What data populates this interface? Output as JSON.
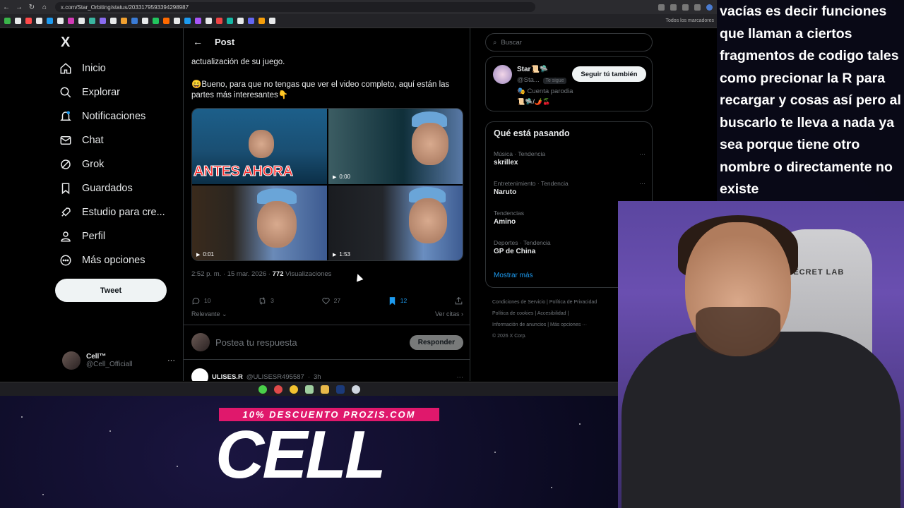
{
  "browser": {
    "url": "x.com/Star_Orbiting/status/2033179593394298987",
    "bookmarks_label": "Todos los marcadores"
  },
  "left_nav": {
    "logo": "X",
    "items": [
      {
        "label": "Inicio",
        "icon": "home-icon"
      },
      {
        "label": "Explorar",
        "icon": "search-icon"
      },
      {
        "label": "Notificaciones",
        "icon": "bell-icon"
      },
      {
        "label": "Chat",
        "icon": "mail-icon"
      },
      {
        "label": "Grok",
        "icon": "grok-icon"
      },
      {
        "label": "Guardados",
        "icon": "bookmark-icon"
      },
      {
        "label": "Estudio para cre...",
        "icon": "rocket-icon"
      },
      {
        "label": "Perfil",
        "icon": "person-icon"
      },
      {
        "label": "Más opciones",
        "icon": "more-circle-icon"
      }
    ],
    "tweet_button": "Tweet",
    "account": {
      "name": "Cell™",
      "handle": "@Cell_Officiall"
    }
  },
  "post": {
    "header_title": "Post",
    "text_top": "actualización de su juego.",
    "text_main": "😄Bueno, para que no tengas que ver el video completo, aquí están las partes más interesantes👇",
    "media": {
      "thumb1_overlay": "ANTES AHORA",
      "thumb2_duration": "0:00",
      "thumb3_duration": "0:01",
      "thumb4_duration": "1:53"
    },
    "time": "2:52 p. m.",
    "date": "15 mar. 2026",
    "views_count": "772",
    "views_label": "Visualizaciones",
    "actions": {
      "replies": "10",
      "reposts": "3",
      "likes": "27",
      "bookmarks": "12"
    },
    "sort_label": "Relevante",
    "quotes_label": "Ver citas",
    "reply_placeholder": "Postea tu respuesta",
    "reply_button": "Responder",
    "next_reply": {
      "name": "ULISES.R",
      "handle": "@ULISESR495587",
      "time": "3h"
    }
  },
  "right": {
    "search_placeholder": "Buscar",
    "profile": {
      "name": "Star📜🛸",
      "handle": "@Sta...",
      "follows_you": "Te sigue",
      "parody": "Cuenta parodia",
      "emojis": "📜🛸/🌶️🍒",
      "follow_button": "Seguir tú también"
    },
    "trends_title": "Qué está pasando",
    "trends": [
      {
        "category": "Música · Tendencia",
        "title": "skrillex"
      },
      {
        "category": "Entretenimiento · Tendencia",
        "title": "Naruto"
      },
      {
        "category": "Tendencias",
        "title": "Amino"
      },
      {
        "category": "Deportes · Tendencia",
        "title": "GP de China"
      }
    ],
    "show_more": "Mostrar más",
    "footer": {
      "terms": "Condiciones de Servicio",
      "privacy": "Política de Privacidad",
      "cookies": "Política de cookies",
      "accessibility": "Accesibilidad",
      "ads": "Información de anuncios",
      "more": "Más opciones ···",
      "copyright": "© 2026 X Corp."
    }
  },
  "overlay_caption": "vacías es decir funciones que llaman a ciertos fragmentos de codigo tales como precionar la R para recargar y cosas así pero al buscarlo te lleva a nada ya sea porque tiene otro nombre o directamente no existe",
  "promo": {
    "banner": "10% DESCUENTO PROZIS.COM",
    "name": "CELL"
  },
  "webcam": {
    "chair_logo": "SECRET LAB"
  },
  "colors": {
    "accent": "#1d9bf0",
    "promo": "#e0186c",
    "background": "#000000"
  }
}
